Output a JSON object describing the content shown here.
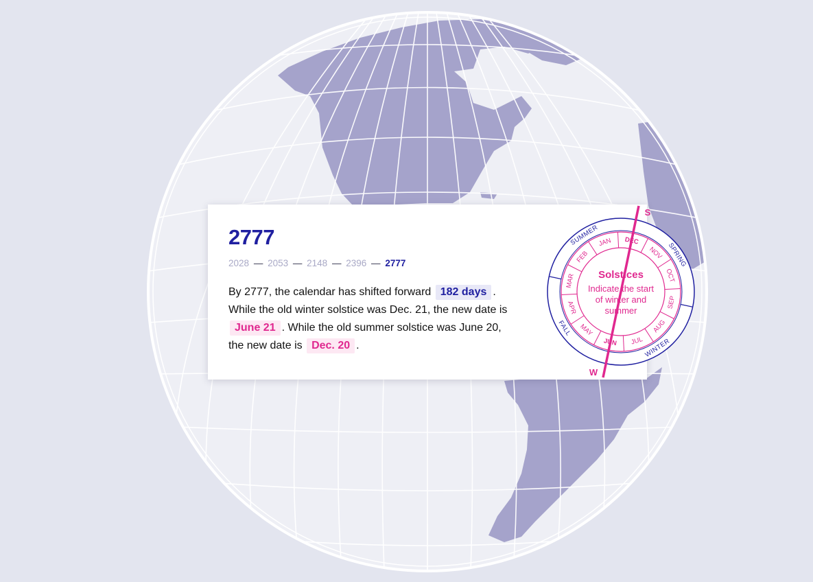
{
  "card": {
    "year": "2777",
    "timeline": [
      "2028",
      "2053",
      "2148",
      "2396",
      "2777"
    ],
    "timeline_active_index": 4,
    "timeline_separator": "—",
    "text": {
      "p1": "By 2777, the calendar has shifted forward",
      "shift": "182 days",
      "p2": ".",
      "p3": "While the old winter solstice was Dec. 21, the new date is",
      "winter_new": "June 21",
      "p4": ". While the old summer solstice was June 20, the new date is",
      "summer_new": "Dec. 20",
      "p5": "."
    }
  },
  "wheel": {
    "center_title": "Solstices",
    "center_line1": "Indicate the start",
    "center_line2": "of winter and",
    "center_line3": "summer",
    "months": [
      "DEC",
      "NOV",
      "OCT",
      "SEP",
      "AUG",
      "JUL",
      "JUN",
      "MAY",
      "APR",
      "MAR",
      "FEB",
      "JAN"
    ],
    "bold_months": [
      "DEC",
      "JUN"
    ],
    "seasons": [
      "SPRING",
      "WINTER",
      "FALL",
      "SUMMER"
    ],
    "marker_summer": "S",
    "marker_winter": "W"
  },
  "colors": {
    "background": "#e3e5ef",
    "globe_ocean": "#eeeff5",
    "land": "#a5a3cb",
    "graticule": "#ffffff",
    "accent_blue": "#1f1fa0",
    "accent_pink": "#e0288f"
  }
}
